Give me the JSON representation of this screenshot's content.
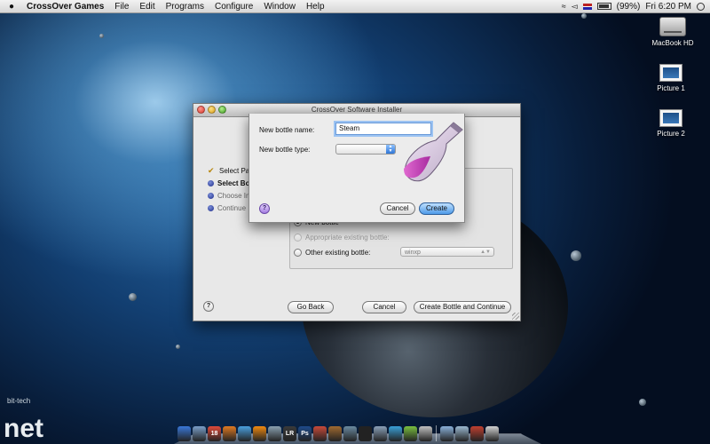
{
  "menubar": {
    "app": "CrossOver Games",
    "menus": [
      "File",
      "Edit",
      "Programs",
      "Configure",
      "Window",
      "Help"
    ],
    "battery": "(99%)",
    "clock": "Fri 6:20 PM"
  },
  "desktop": {
    "icons": [
      {
        "label": "MacBook HD",
        "icon": "hard-drive-icon"
      },
      {
        "label": "Picture 1",
        "icon": "picture-file-icon"
      },
      {
        "label": "Picture 2",
        "icon": "picture-file-icon"
      }
    ]
  },
  "installer": {
    "title": "CrossOver Software Installer",
    "steps": [
      {
        "label": "Select Package",
        "state": "done"
      },
      {
        "label": "Select Bottle",
        "state": "current"
      },
      {
        "label": "Choose Installer",
        "state": "pending"
      },
      {
        "label": "Continue",
        "state": "pending"
      }
    ],
    "options": {
      "new_bottle": "New bottle",
      "appropriate_existing": "Appropriate existing bottle:",
      "other_existing": "Other existing bottle:",
      "other_existing_value": "winxp"
    },
    "buttons": {
      "go_back": "Go Back",
      "cancel": "Cancel",
      "create_continue": "Create Bottle and Continue",
      "help": "?"
    }
  },
  "sheet": {
    "name_label": "New bottle name:",
    "name_value": "Steam",
    "type_label": "New bottle type:",
    "type_value": "",
    "help": "?",
    "cancel": "Cancel",
    "create": "Create"
  },
  "dock": {
    "items": [
      {
        "name": "finder",
        "glyph": "",
        "color": "#3a78d8"
      },
      {
        "name": "mail",
        "glyph": "",
        "color": "#7a9ec8"
      },
      {
        "name": "ical",
        "glyph": "18",
        "color": "#e04a3a"
      },
      {
        "name": "firefox",
        "glyph": "",
        "color": "#e07a22"
      },
      {
        "name": "safari",
        "glyph": "",
        "color": "#4aa0e0"
      },
      {
        "name": "vlc",
        "glyph": "",
        "color": "#f08a10"
      },
      {
        "name": "preview",
        "glyph": "",
        "color": "#8aa0b0"
      },
      {
        "name": "lightroom",
        "glyph": "LR",
        "color": "#3a3a3a"
      },
      {
        "name": "photoshop",
        "glyph": "Ps",
        "color": "#1e4a8a"
      },
      {
        "name": "app-9",
        "glyph": "",
        "color": "#c84a3a"
      },
      {
        "name": "app-10",
        "glyph": "",
        "color": "#a06a30"
      },
      {
        "name": "app-11",
        "glyph": "",
        "color": "#6a8aa0"
      },
      {
        "name": "terminal",
        "glyph": "",
        "color": "#222222"
      },
      {
        "name": "app-13",
        "glyph": "",
        "color": "#8aa0b8"
      },
      {
        "name": "app-14",
        "glyph": "",
        "color": "#3aa0d8"
      },
      {
        "name": "app-15",
        "glyph": "",
        "color": "#7ac040"
      },
      {
        "name": "app-16",
        "glyph": "",
        "color": "#c0c0c0"
      }
    ],
    "stack_items": [
      {
        "name": "documents",
        "glyph": "",
        "color": "#8ab0d8"
      },
      {
        "name": "downloads",
        "glyph": "",
        "color": "#9ab8d0"
      },
      {
        "name": "app-stack",
        "glyph": "",
        "color": "#c04030"
      },
      {
        "name": "trash",
        "glyph": "",
        "color": "#d0d0d0"
      }
    ]
  },
  "watermark": {
    "top": "bit-tech",
    "bottom": "net"
  }
}
